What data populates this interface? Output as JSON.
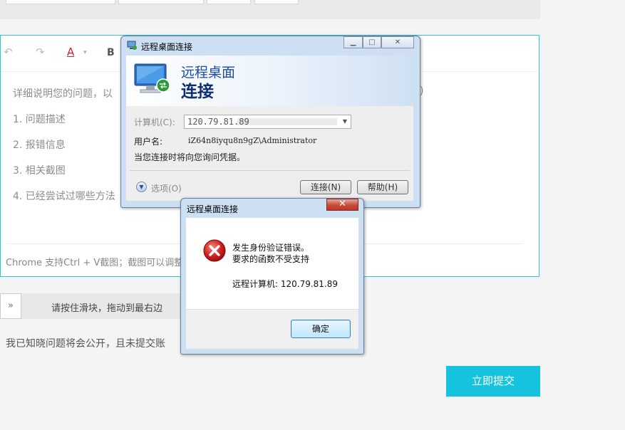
{
  "editor": {
    "lines": [
      "详细说明您的问题，以",
      "1. 问题描述",
      "2. 报错信息",
      "3. 相关截图",
      "4. 已经尝试过哪些方法"
    ],
    "paren_fragment": ")",
    "footer_hint": "Chrome 支持Ctrl + V截图；截图可以调整大",
    "toolbar": {
      "font_color_glyph": "A",
      "bold_glyph": "B"
    }
  },
  "slider": {
    "handle_glyph": "»",
    "text": "请按住滑块，拖动到最右边"
  },
  "notice": "我已知晓问题将会公开，且未提交账",
  "submit_label": "立即提交",
  "rdc": {
    "title": "远程桌面连接",
    "banner_line1": "远程桌面",
    "banner_line2": "连接",
    "computer_label": "计算机(C):",
    "computer_value": "120.79.81.89",
    "username_label": "用户名:",
    "username_value": "iZ64n8iyqu8n9gZ\\Administrator",
    "credentials_note": "当您连接时将向您询问凭据。",
    "options_label": "选项(O)",
    "connect_button": "连接(N)",
    "help_button": "帮助(H)"
  },
  "error_dialog": {
    "title": "远程桌面连接",
    "message_line1": "发生身份验证错误。",
    "message_line2": "要求的函数不受支持",
    "remote_computer": "远程计算机: 120.79.81.89",
    "ok_button": "确定"
  }
}
